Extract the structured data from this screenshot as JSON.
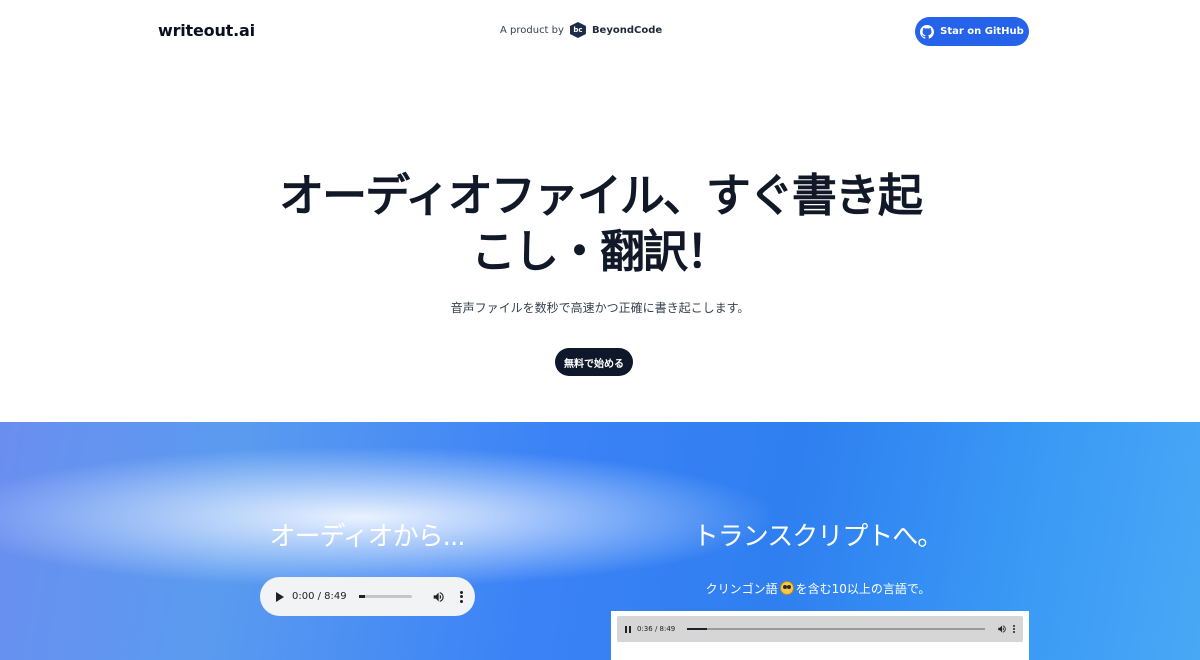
{
  "header": {
    "logo": "writeout.ai",
    "product_by_label": "A product by",
    "product_by_icon_text": "bc",
    "product_by_name": "BeyondCode",
    "github_button_label": "Star on GitHub"
  },
  "hero": {
    "title": "オーディオファイル、すぐ書き起こし・翻訳！",
    "subtitle": "音声ファイルを数秒で高速かつ正確に書き起こします。",
    "cta_label": "無料で始める"
  },
  "section": {
    "left_title": "オーディオから...",
    "right_title": "トランスクリプトへ。",
    "right_sub_prefix": "クリンゴン語",
    "right_sub_suffix": "を含む10以上の言語で。",
    "left_player": {
      "time": "0:00 / 8:49",
      "progress": 0
    },
    "right_player": {
      "time": "0:36 / 8:49",
      "progress": 0.068
    }
  },
  "colors": {
    "primary": "#2563eb",
    "dark": "#0f172a"
  },
  "icons": {
    "github": "github-icon",
    "play": "play-icon",
    "pause": "pause-icon",
    "volume": "volume-icon",
    "more": "more-vert-icon",
    "emoji": "grinning-face-emoji-icon"
  }
}
